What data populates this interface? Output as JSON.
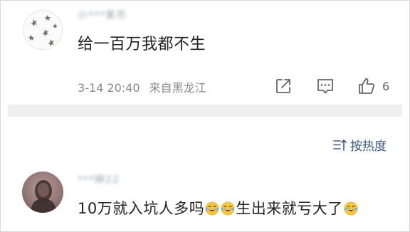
{
  "comment1": {
    "username": "小***某币",
    "text": "给一百万我都不生",
    "timestamp": "3-14 20:40",
    "location": "来自黑龙江",
    "share_icon": "share-icon",
    "reply_icon": "comment-icon",
    "like_icon": "thumbs-up-icon",
    "like_count": "6"
  },
  "sort": {
    "label": "按热度",
    "icon": "sort-icon"
  },
  "comment2": {
    "username": "***婷22",
    "text_part1": "10万就入坑人多吗",
    "text_part2": "生出来就亏大了",
    "emoji_icon": "laughing-tears-emoji"
  },
  "colors": {
    "divider": "#efefef",
    "sort_text": "#3d5a80",
    "meta_text": "#8a8a8a",
    "body_text": "#222222"
  }
}
